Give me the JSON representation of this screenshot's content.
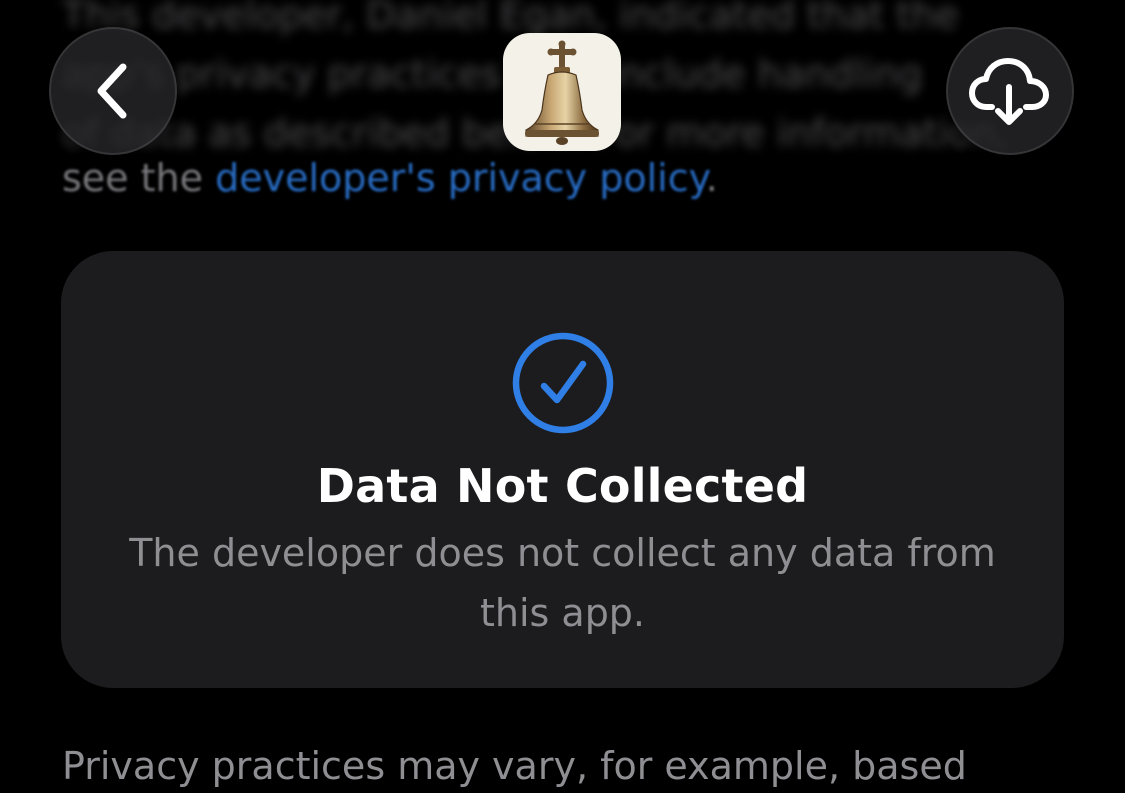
{
  "background_text": {
    "line1": "This developer, Daniel Egan, indicated that the",
    "line2": "app's privacy practices may include handling",
    "line3": "of data as described below. For more information,",
    "line4_prefix": "see the ",
    "line4_link": "developer's privacy policy",
    "line4_suffix": "."
  },
  "nav": {
    "back_icon": "chevron-left-icon",
    "download_icon": "cloud-download-icon",
    "app_icon": "bell-app-icon"
  },
  "card": {
    "icon": "checkmark-circle-icon",
    "title": "Data Not Collected",
    "description": "The developer does not collect any data from this app."
  },
  "footer": {
    "text": "Privacy practices may vary, for example, based"
  },
  "colors": {
    "accent": "#2f7fe6",
    "card_bg": "#1c1c1e",
    "secondary_text": "#8e8e93",
    "page_bg": "#000000"
  }
}
